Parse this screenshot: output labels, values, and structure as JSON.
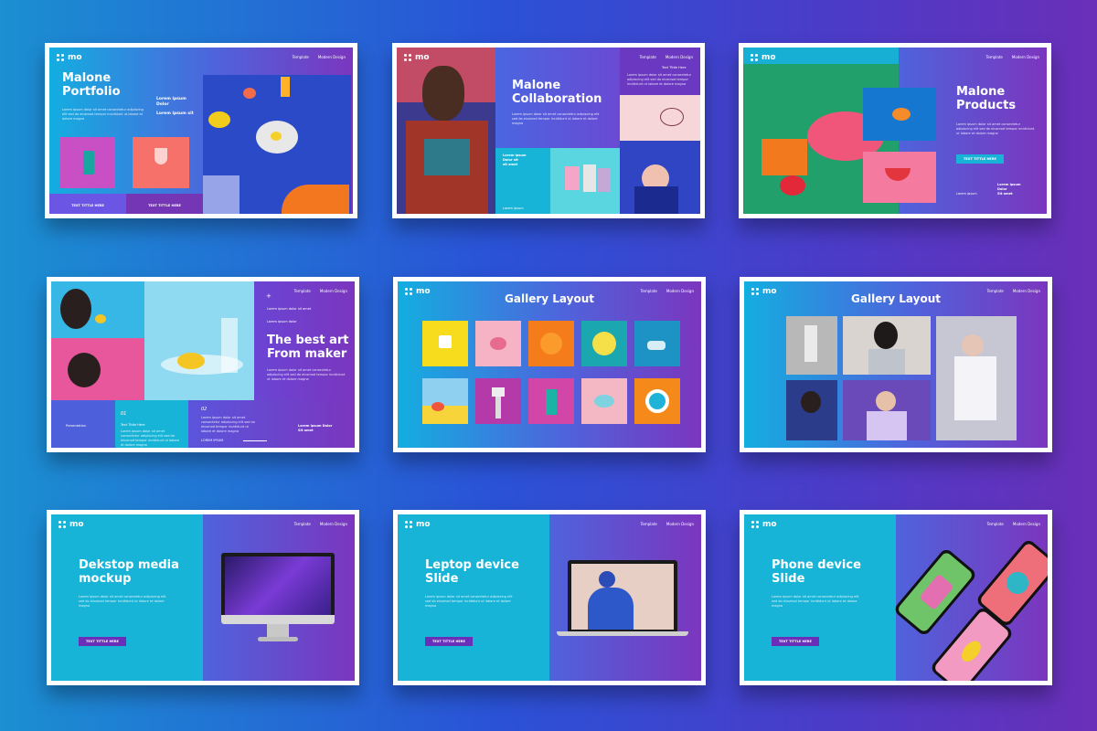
{
  "brand": {
    "logo": "mo"
  },
  "common": {
    "nav_template": "Template",
    "nav_modern": "Modern Design",
    "lorem_body": "Lorem ipsum dolor sit amet consectetur adipiscing elit sed do eiusmod tempor incididunt ut labore et dolore magna",
    "button_text": "TEXT TITTLE HERE"
  },
  "slides": {
    "portfolio": {
      "title_line1": "Malone",
      "title_line2": "Portfolio",
      "sub_line1": "Lorem ipsum",
      "sub_line2": "Dolor",
      "sub_line3": "Lorem ipsum sit",
      "button_left": "TEXT TITTLE HERE",
      "button_right": "TEXT TITTLE HERE"
    },
    "collaboration": {
      "title_line1": "Malone",
      "title_line2": "Collaboration",
      "top_label": "Text Tittle Here",
      "mid_line1": "Lorem ipsum",
      "mid_line2": "Dolor sit",
      "mid_line3": "sit amet",
      "bottom_label": "Lorem ipsum"
    },
    "products": {
      "title_line1": "Malone",
      "title_line2": "Products",
      "button": "TEXT TITTLE HERE",
      "bottom_left": "Lorem ipsum",
      "bottom_right1": "Lorem ipsum",
      "bottom_right2": "Dolor",
      "bottom_right3": "Sit amet"
    },
    "bestart": {
      "title_line1": "The best art",
      "title_line2": "From maker",
      "top_text": "Lorem ipsum dolor sit amet",
      "sub_text": "Lorem ipsum dolor",
      "presentation": "Presentation",
      "num1": "01",
      "num2": "02",
      "text_title": "Text Tittle Here",
      "lorem_right1": "Lorem ipsum Dolor",
      "lorem_right2": "Sit amet",
      "lorem_ipsum_caps": "LOREM IPSUM"
    },
    "gallery1": {
      "title": "Gallery Layout"
    },
    "gallery2": {
      "title": "Gallery Layout"
    },
    "desktop": {
      "title_line1": "Dekstop media",
      "title_line2": "mockup"
    },
    "laptop": {
      "title_line1": "Leptop device",
      "title_line2": "Slide"
    },
    "phone": {
      "title_line1": "Phone device",
      "title_line2": "Slide"
    }
  },
  "colors": {
    "accent_purple": "#7b36be",
    "accent_cyan": "#13aee0",
    "button_purple": "#6a2fb8",
    "button_cyan": "#18b4d8"
  }
}
